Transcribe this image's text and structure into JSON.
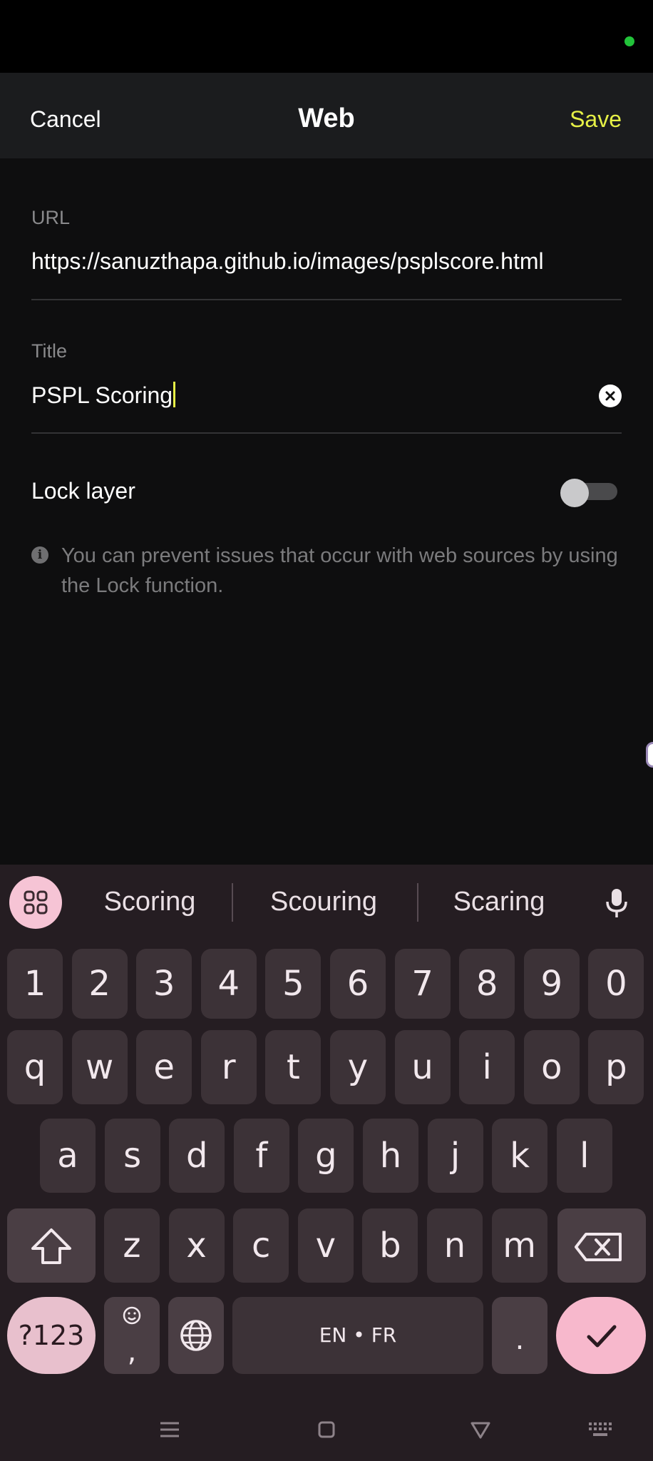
{
  "colors": {
    "accent": "#e6f046",
    "status_dot": "#22c33a",
    "caret": "#e6f046"
  },
  "header": {
    "cancel_label": "Cancel",
    "title": "Web",
    "save_label": "Save"
  },
  "form": {
    "url": {
      "label": "URL",
      "value": "https://sanuzthapa.github.io/images/psplscore.html"
    },
    "title": {
      "label": "Title",
      "value": "PSPL Scoring"
    },
    "lock_layer": {
      "label": "Lock layer",
      "enabled": false
    },
    "info": "You can prevent issues that occur with web sources by using the Lock function."
  },
  "keyboard": {
    "suggestions": [
      "Scoring",
      "Scouring",
      "Scaring"
    ],
    "number_row": [
      "1",
      "2",
      "3",
      "4",
      "5",
      "6",
      "7",
      "8",
      "9",
      "0"
    ],
    "row1": [
      "q",
      "w",
      "e",
      "r",
      "t",
      "y",
      "u",
      "i",
      "o",
      "p"
    ],
    "row2": [
      "a",
      "s",
      "d",
      "f",
      "g",
      "h",
      "j",
      "k",
      "l"
    ],
    "row3": [
      "z",
      "x",
      "c",
      "v",
      "b",
      "n",
      "m"
    ],
    "symbols_label": "?123",
    "comma_label": ",",
    "space_label": "EN • FR",
    "period_label": "."
  },
  "icons": {
    "clear": "clear-circle-icon",
    "info": "info-icon",
    "apps": "grid-icon",
    "mic": "microphone-icon",
    "shift": "shift-arrow-icon",
    "backspace": "backspace-icon",
    "emoji": "smiley-icon",
    "globe": "globe-icon",
    "enter": "checkmark-icon",
    "nav_menu": "menu-lines-icon",
    "nav_home": "square-icon",
    "nav_back": "triangle-down-icon",
    "nav_keyboard": "keyboard-icon"
  }
}
